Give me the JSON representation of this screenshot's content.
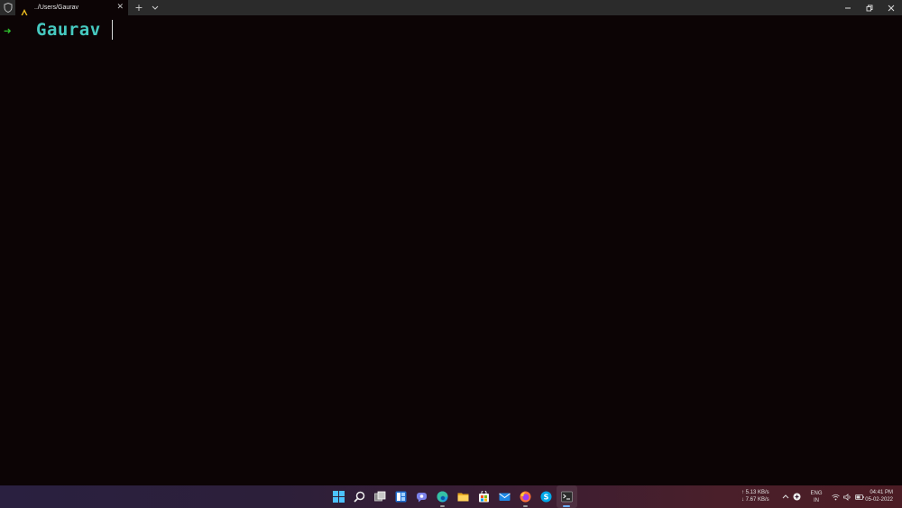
{
  "titlebar": {
    "tab_title": "../Users/Gaurav",
    "tab_close": "✕",
    "new_tab": "+"
  },
  "terminal": {
    "prompt_arrow": "➜",
    "directory": "Gaurav"
  },
  "taskbar": {
    "apps": [
      "start",
      "search",
      "task-view",
      "widgets",
      "teams-chat",
      "edge",
      "file-explorer",
      "microsoft-store",
      "mail",
      "firefox",
      "skype",
      "terminal"
    ],
    "network": {
      "upload": "↑ 5.13 KB/s",
      "download": "↓ 7.67 KB/s"
    },
    "language": {
      "line1": "ENG",
      "line2": "IN"
    },
    "clock": {
      "time": "04:41 PM",
      "date": "05-02-2022"
    }
  },
  "colors": {
    "terminal_bg": "#0c0405",
    "prompt_arrow": "#2ec22e",
    "directory": "#46c9c0",
    "titlebar_bg": "#2b2b2b"
  }
}
